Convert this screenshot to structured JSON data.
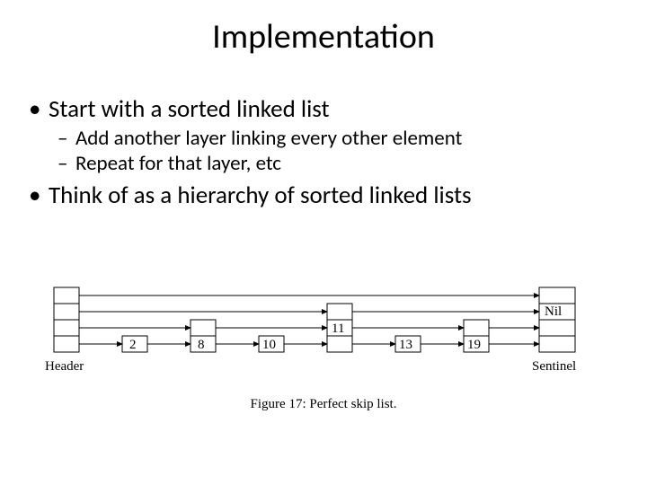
{
  "title": "Implementation",
  "bullets": {
    "b1a": "Start with a sorted linked list",
    "b2a": "Add another layer linking every other element",
    "b2b": "Repeat for that layer, etc",
    "b1b": "Think of as a hierarchy of sorted linked lists"
  },
  "figure": {
    "header_label": "Header",
    "sentinel_label": "Sentinel",
    "nil_label": "Nil",
    "caption": "Figure 17: Perfect skip list.",
    "nodes": {
      "n0": "2",
      "n1": "8",
      "n2": "10",
      "n3": "11",
      "n4": "13",
      "n5": "19"
    }
  },
  "chart_data": {
    "type": "diagram",
    "structure": "skip-list",
    "levels": 4,
    "header_levels": 4,
    "sentinel_levels": 4,
    "elements": [
      {
        "value": 2,
        "levels": 1
      },
      {
        "value": 8,
        "levels": 2
      },
      {
        "value": 10,
        "levels": 1
      },
      {
        "value": 11,
        "levels": 3
      },
      {
        "value": 13,
        "levels": 1
      },
      {
        "value": 19,
        "levels": 2
      }
    ],
    "links": {
      "level0": [
        "Header",
        2,
        8,
        10,
        11,
        13,
        19,
        "Sentinel"
      ],
      "level1": [
        "Header",
        8,
        11,
        19,
        "Sentinel"
      ],
      "level2": [
        "Header",
        11,
        "Sentinel"
      ],
      "level3": [
        "Header",
        "Sentinel"
      ]
    },
    "caption": "Figure 17: Perfect skip list."
  }
}
